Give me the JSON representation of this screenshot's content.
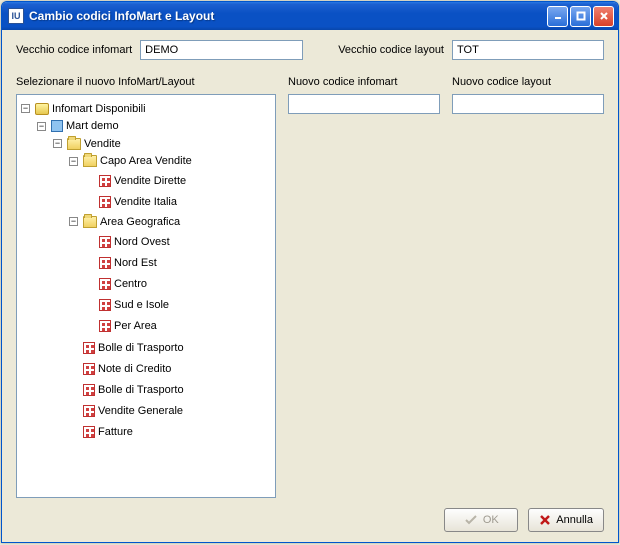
{
  "window": {
    "title": "Cambio codici InfoMart e Layout",
    "app_icon_letter": "IU"
  },
  "labels": {
    "old_infomart_code": "Vecchio codice infomart",
    "old_layout_code": "Vecchio codice layout",
    "select_new": "Selezionare il nuovo InfoMart/Layout",
    "new_infomart_code": "Nuovo codice infomart",
    "new_layout_code": "Nuovo codice layout"
  },
  "fields": {
    "old_infomart_value": "DEMO",
    "old_layout_value": "TOT",
    "new_infomart_value": "",
    "new_layout_value": ""
  },
  "tree": {
    "root": "Infomart Disponibili",
    "mart": "Mart demo",
    "vendite": "Vendite",
    "capo_area": "Capo Area Vendite",
    "capo_area_children": [
      "Vendite Dirette",
      "Vendite Italia"
    ],
    "area_geo": "Area Geografica",
    "area_geo_children": [
      "Nord Ovest",
      "Nord Est",
      "Centro",
      "Sud e Isole",
      "Per Area"
    ],
    "vendite_tail": [
      "Bolle di Trasporto",
      "Note di Credito",
      "Bolle di Trasporto",
      "Vendite Generale",
      "Fatture"
    ]
  },
  "buttons": {
    "ok": "OK",
    "cancel": "Annulla"
  }
}
